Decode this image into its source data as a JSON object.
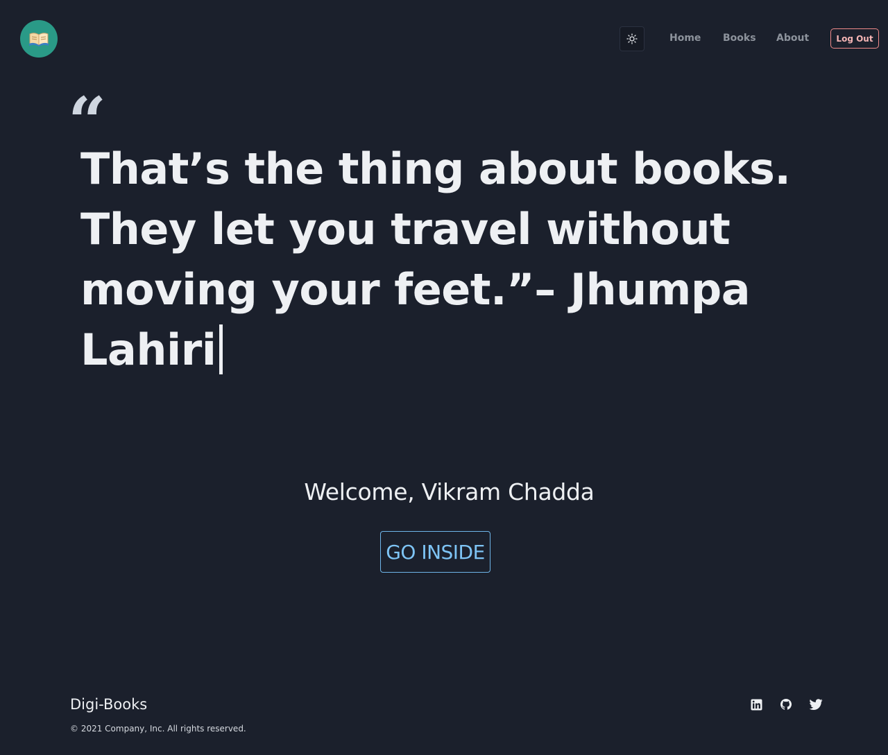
{
  "header": {
    "logo_icon": "open-book-icon",
    "theme_toggle_icon": "sun-icon",
    "nav": [
      {
        "label": "Home"
      },
      {
        "label": "Books"
      },
      {
        "label": "About"
      }
    ],
    "logout_label": "Log Out"
  },
  "hero": {
    "quote_mark": "“",
    "quote_text": "That’s the thing about books. They let you travel without moving your feet.”– Jhumpa Lahiri"
  },
  "welcome": {
    "text": "Welcome, Vikram Chadda",
    "button_label": "GO INSIDE"
  },
  "footer": {
    "brand": "Digi-Books",
    "copyright": "© 2021 Company, Inc. All rights reserved.",
    "social": [
      "linkedin-icon",
      "github-icon",
      "twitter-icon"
    ]
  },
  "colors": {
    "background": "#1b202c",
    "logo_bg": "#2a9a87",
    "logout_border": "#f08a8a",
    "go_inside": "#7ec4f5"
  }
}
